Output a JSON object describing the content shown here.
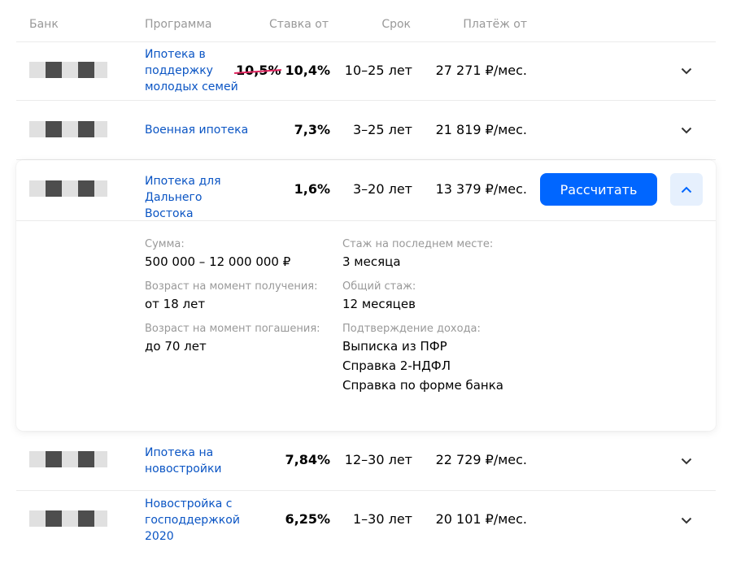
{
  "header": {
    "bank": "Банк",
    "program": "Программа",
    "rate": "Ставка от",
    "term": "Срок",
    "payment": "Платёж от"
  },
  "rows": [
    {
      "program": "Ипотека в поддержку молодых семей",
      "old_rate": "10,5%",
      "rate": "10,4%",
      "term": "10–25 лет",
      "payment": "27 271 ₽/мес."
    },
    {
      "program": "Военная ипотека",
      "rate": "7,3%",
      "term": "3–25 лет",
      "payment": "21 819 ₽/мес."
    },
    {
      "program": "Ипотека для Дальнего Востока",
      "rate": "1,6%",
      "term": "3–20 лет",
      "payment": "13 379 ₽/мес.",
      "button": "Рассчитать",
      "details": {
        "left": [
          {
            "label": "Сумма:",
            "value": "500 000 – 12 000 000 ₽"
          },
          {
            "label": "Возраст на момент получения:",
            "value": "от 18 лет"
          },
          {
            "label": "Возраст на момент погашения:",
            "value": "до 70 лет"
          }
        ],
        "right": [
          {
            "label": "Стаж на последнем месте:",
            "value": "3 месяца"
          },
          {
            "label": "Общий стаж:",
            "value": "12 месяцев"
          },
          {
            "label": "Подтверждение дохода:",
            "values": [
              "Выписка из ПФР",
              "Справка 2-НДФЛ",
              "Справка по форме банка"
            ]
          }
        ]
      }
    },
    {
      "program": "Ипотека на новостройки",
      "rate": "7,84%",
      "term": "12–30 лет",
      "payment": "22 729 ₽/мес."
    },
    {
      "program": "Новостройка с господдержкой 2020",
      "rate": "6,25%",
      "term": "1–30 лет",
      "payment": "20 101 ₽/мес."
    }
  ],
  "icons": {
    "chevron_down": "chevron-down-icon",
    "chevron_up": "chevron-up-icon"
  },
  "colors": {
    "link": "#0b55c4",
    "button": "#0066ff",
    "strike": "#e0245e",
    "muted": "#999999"
  }
}
